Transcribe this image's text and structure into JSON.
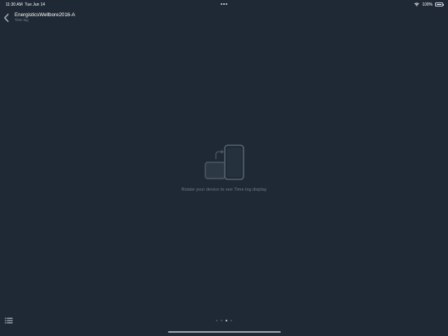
{
  "status_bar": {
    "time": "11:30 AM",
    "date": "Tue Jun 14",
    "battery_percent": "100%",
    "wifi_icon": "wifi-icon",
    "battery_icon": "battery-icon",
    "battery_level": 1.0
  },
  "header": {
    "title": "EnergisticsWellbore2016-A",
    "subtitle": "Time log",
    "back_icon": "chevron-left-icon"
  },
  "main": {
    "illustration_icon": "rotate-device-icon",
    "message": "Rotate your device to see Time log display"
  },
  "footer": {
    "list_icon": "list-icon",
    "page_indicator": {
      "total": 4,
      "current": 3
    }
  },
  "colors": {
    "background": "#1f2935",
    "title_text": "#ffffff",
    "muted_text": "#6f7b8a",
    "illustration": "#556170",
    "active_dot": "#dfe3e8",
    "inactive_dot": "#4d5866"
  }
}
